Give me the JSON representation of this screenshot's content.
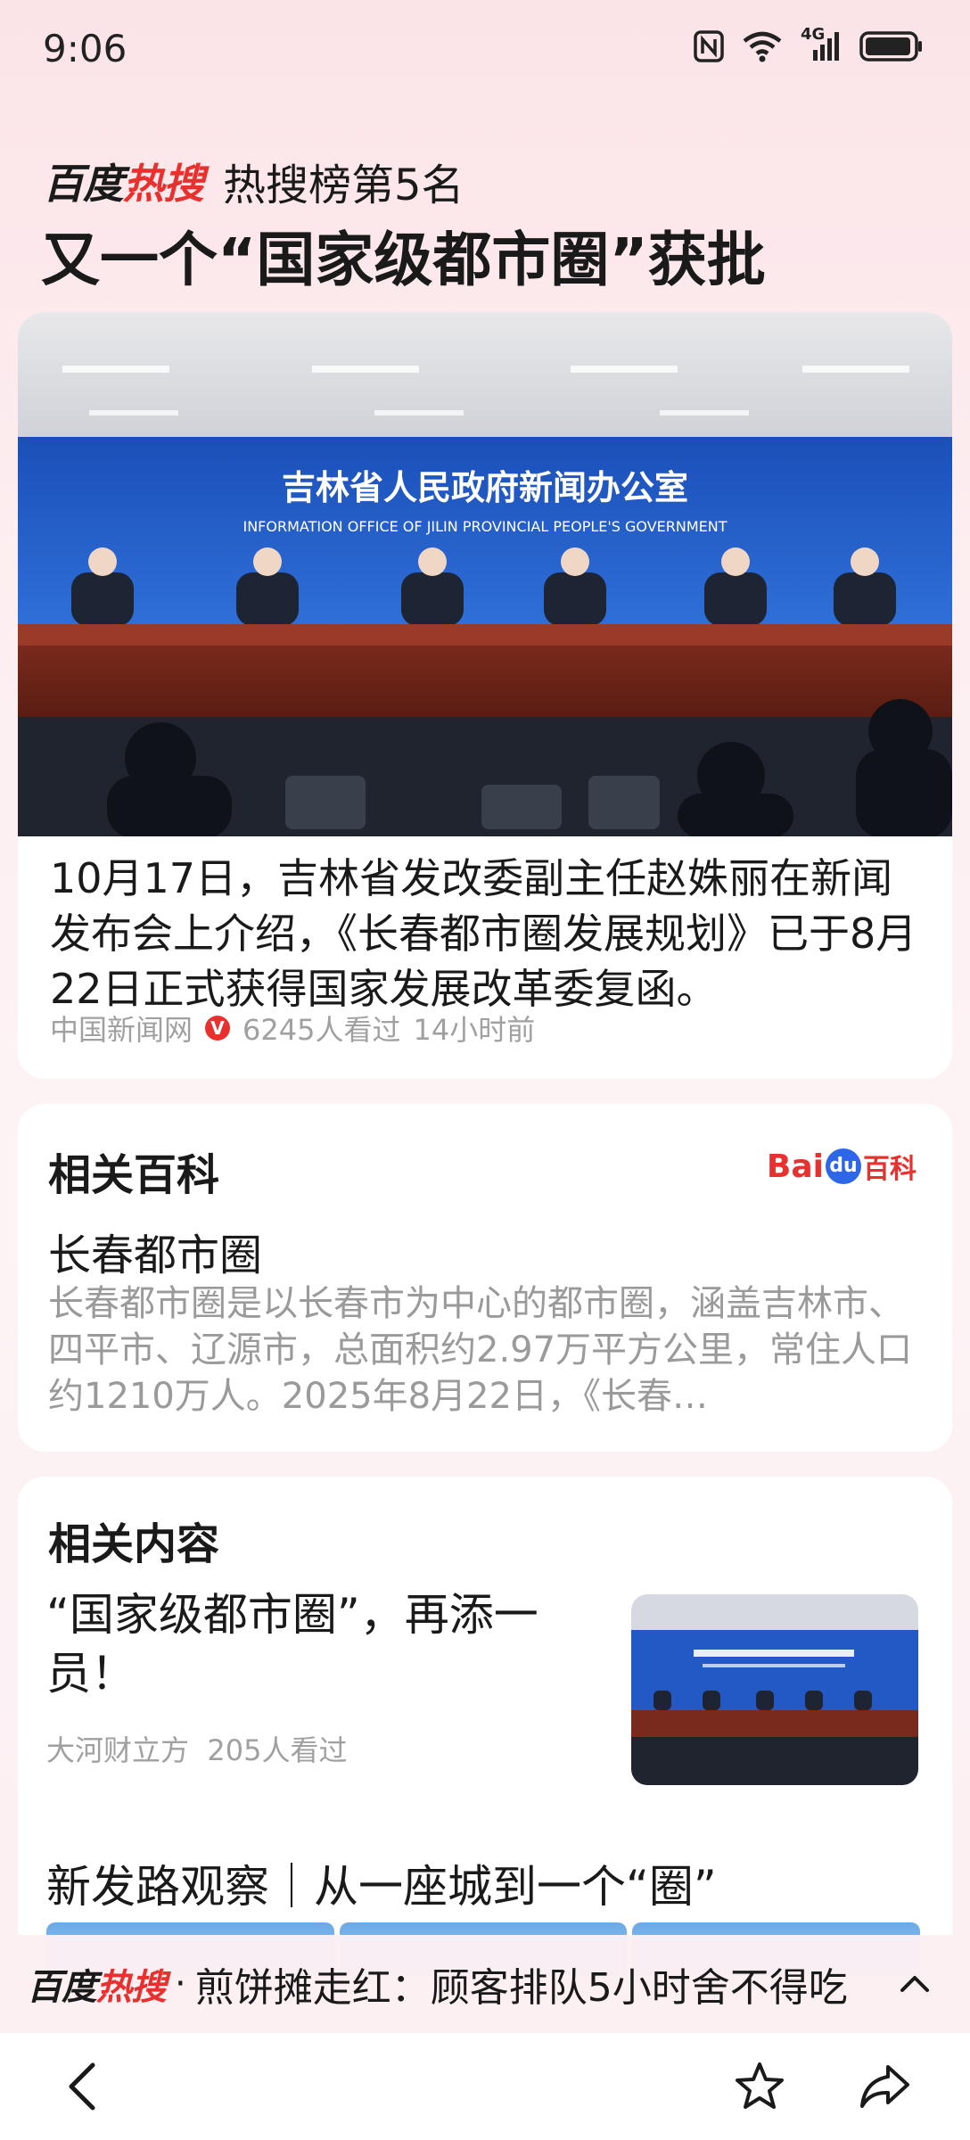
{
  "status_bar": {
    "time": "9:06",
    "icons": [
      "nfc-icon",
      "wifi-icon",
      "signal-4g-icon",
      "battery-icon"
    ],
    "network_label": "4G"
  },
  "header": {
    "logo_text_black": "百度",
    "logo_text_red": "热搜",
    "rank": "热搜榜第5名",
    "headline": "又一个“国家级都市圈”获批"
  },
  "news_card": {
    "image_signboard_cn": "吉林省人民政府新闻办公室",
    "image_signboard_en": "INFORMATION OFFICE OF JILIN PROVINCIAL PEOPLE'S GOVERNMENT",
    "body": "10月17日，吉林省发改委副主任赵姝丽在新闻发布会上介绍，《长春都市圈发展规划》已于8月22日正式获得国家发展改革委复函。",
    "source": "中国新闻网",
    "verified_mark": "V",
    "views": "6245人看过",
    "time_ago": "14小时前"
  },
  "baike_card": {
    "title": "相关百科",
    "logo_bai": "Bai",
    "logo_du": "du",
    "logo_baike": "百科",
    "term": "长春都市圈",
    "description": "长春都市圈是以长春市为中心的都市圈，涵盖吉林市、四平市、辽源市，总面积约2.97万平方公里，常住人口约1210万人。2025年8月22日，《长春…"
  },
  "related_card": {
    "title": "相关内容",
    "items": [
      {
        "title": "“国家级都市圈”，再添一员！",
        "source": "大河财立方",
        "views": "205人看过"
      },
      {
        "title": "新发路观察｜从一座城到一个“圈”"
      }
    ]
  },
  "ticker": {
    "logo_text_black": "百度",
    "logo_text_red": "热搜",
    "separator": "·",
    "text": "煎饼摊走红：顾客排队5小时舍不得吃"
  },
  "nav": {
    "icons": [
      "back-icon",
      "star-icon",
      "share-icon"
    ]
  },
  "colors": {
    "accent_red": "#e8312f",
    "baidu_blue": "#2d67e8",
    "meta_gray": "#a0a0a0"
  }
}
